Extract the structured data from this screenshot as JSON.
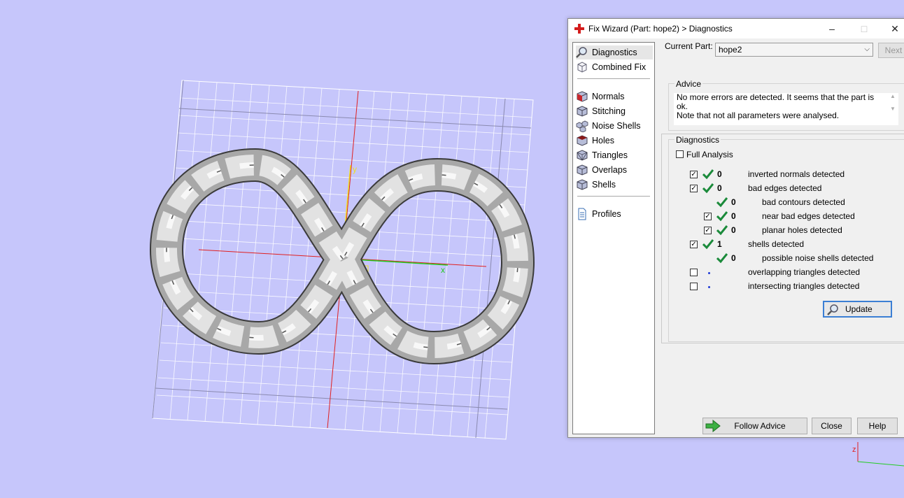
{
  "viewport": {
    "axis_labels": {
      "y": "y",
      "x": "x",
      "z": "z"
    },
    "wcs_label": "WCS"
  },
  "wizard": {
    "title": "Fix Wizard (Part: hope2) > Diagnostics",
    "nav": {
      "group1": [
        "Diagnostics",
        "Combined Fix"
      ],
      "group2": [
        "Normals",
        "Stitching",
        "Noise Shells",
        "Holes",
        "Triangles",
        "Overlaps",
        "Shells"
      ],
      "group3": [
        "Profiles"
      ]
    },
    "current_part_label": "Current Part:",
    "current_part_value": "hope2",
    "next_label": "Next",
    "advice": {
      "legend": "Advice",
      "line1": "No more errors are detected. It seems that the part is ok.",
      "line2": "Note that not all parameters were analysed."
    },
    "diagnostics": {
      "legend": "Diagnostics",
      "full_analysis": "Full Analysis",
      "rows": [
        {
          "count": "0",
          "label": "inverted normals detected",
          "checked": true,
          "ok": true
        },
        {
          "count": "0",
          "label": "bad edges detected",
          "checked": true,
          "ok": true
        },
        {
          "count": "0",
          "label": "bad contours detected",
          "checked": null,
          "ok": true
        },
        {
          "count": "0",
          "label": "near bad edges detected",
          "checked": true,
          "ok": true
        },
        {
          "count": "0",
          "label": "planar holes detected",
          "checked": true,
          "ok": true
        },
        {
          "count": "1",
          "label": "shells detected",
          "checked": true,
          "ok": true
        },
        {
          "count": "0",
          "label": "possible noise shells detected",
          "checked": null,
          "ok": true
        },
        {
          "count": "",
          "label": "overlapping triangles detected",
          "checked": false,
          "ok": false
        },
        {
          "count": "",
          "label": "intersecting triangles detected",
          "checked": false,
          "ok": false
        }
      ],
      "update_label": "Update"
    },
    "buttons": {
      "follow_advice": "Follow Advice",
      "close": "Close",
      "help": "Help"
    }
  }
}
